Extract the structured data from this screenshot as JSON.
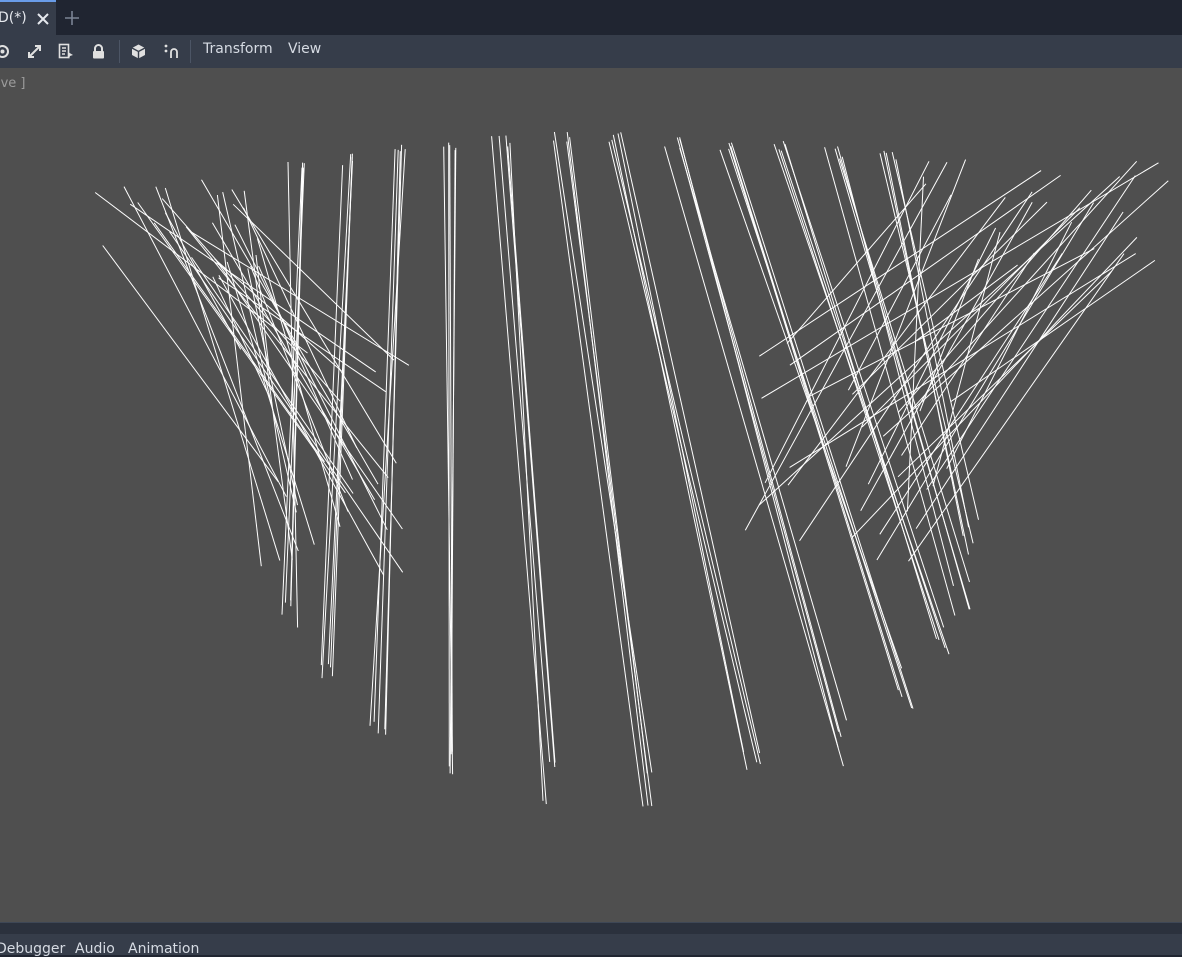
{
  "scene_tab": {
    "label": "D(*)",
    "close_icon": "close-icon",
    "add_icon": "plus-icon"
  },
  "toolbar": {
    "icons": [
      "rotate-icon",
      "scale-icon",
      "list-select-icon",
      "lock-icon",
      "mesh-cube-icon",
      "pivot-icon"
    ],
    "transform_label": "Transform",
    "view_label": "View"
  },
  "viewport": {
    "label": "ive ]",
    "line_color": "#ffffff",
    "background_color": "#4f4f4f"
  },
  "bottom_panel": {
    "tabs": [
      "Debugger",
      "Audio",
      "Animation"
    ]
  }
}
